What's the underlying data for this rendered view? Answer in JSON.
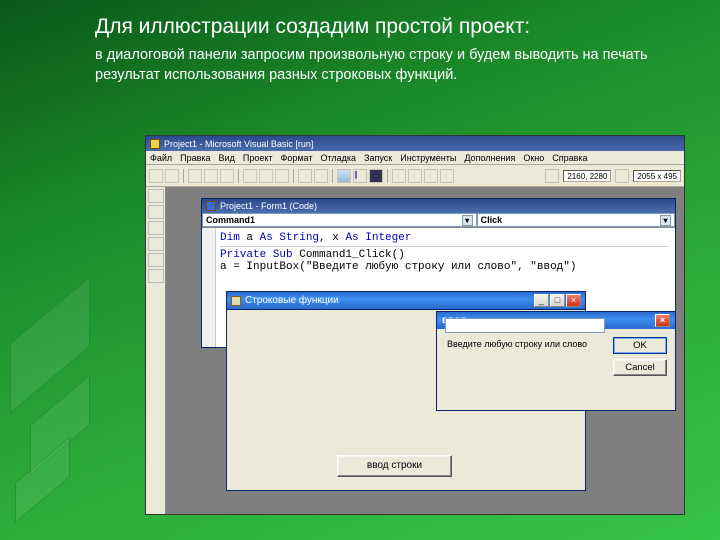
{
  "slide": {
    "title": "Для иллюстрации создадим простой проект:",
    "body": "в диалоговой панели запросим произвольную строку и будем выводить на печать результат использования разных строковых функций."
  },
  "vb": {
    "main_title": "Project1 - Microsoft Visual Basic [run]",
    "menu": [
      "Файл",
      "Правка",
      "Вид",
      "Проект",
      "Формат",
      "Отладка",
      "Запуск",
      "Инструменты",
      "Дополнения",
      "Окно",
      "Справка"
    ],
    "coords1": "2160, 2280",
    "coords2": "2055 x 495"
  },
  "codewin": {
    "title": "Project1 - Form1 (Code)",
    "combo_left": "Command1",
    "combo_right": "Click",
    "line1_a": "Dim",
    "line1_b": " a ",
    "line1_c": "As String",
    "line1_d": ", x ",
    "line1_e": "As Integer",
    "line2_a": "Private Sub",
    "line2_b": " Command1_Click()",
    "line3_a": "a = InputBox(",
    "line3_b": "\"Введите любую строку или слово\", \"ввод\")"
  },
  "formwin": {
    "title": "Строковые функции",
    "button1": "ввод строки"
  },
  "inputbox": {
    "title": "ввод",
    "prompt": "Введите любую строку или слово",
    "ok": "OK",
    "cancel": "Cancel"
  }
}
